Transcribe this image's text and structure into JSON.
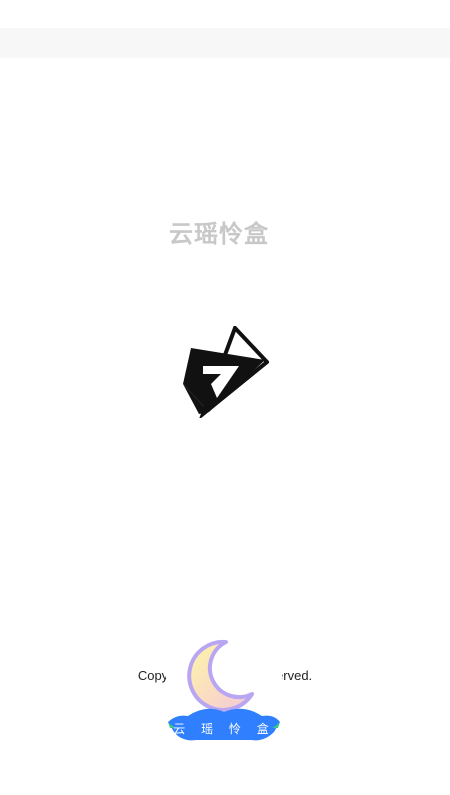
{
  "splash": {
    "app_title": "云瑶怜盒",
    "copyright_text": "Copyright @ 2                   ghts Reserved."
  },
  "badge": {
    "label": "云 瑶 怜 盒"
  },
  "colors": {
    "title": "#c8c8c8",
    "logo": "#111111",
    "moon_fill": "#f6ec9c",
    "moon_outline": "#b9a6f2",
    "badge_blue": "#2f7fff",
    "badge_green": "#39c98a"
  },
  "icons": {
    "logo": "star-logo-icon",
    "moon": "moon-icon"
  }
}
